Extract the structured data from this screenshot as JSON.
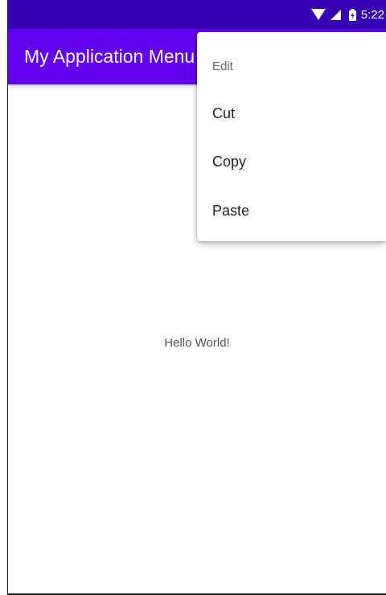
{
  "status_bar": {
    "time": "5:22",
    "icons": [
      "wifi-icon",
      "signal-icon",
      "battery-icon"
    ]
  },
  "app_bar": {
    "title": "My Application Menu Demo"
  },
  "main": {
    "text": "Hello World!"
  },
  "menu": {
    "header": "Edit",
    "items": [
      {
        "label": "Cut"
      },
      {
        "label": "Copy"
      },
      {
        "label": "Paste"
      }
    ]
  },
  "colors": {
    "status_bar": "#3700B3",
    "app_bar": "#6200EE"
  }
}
